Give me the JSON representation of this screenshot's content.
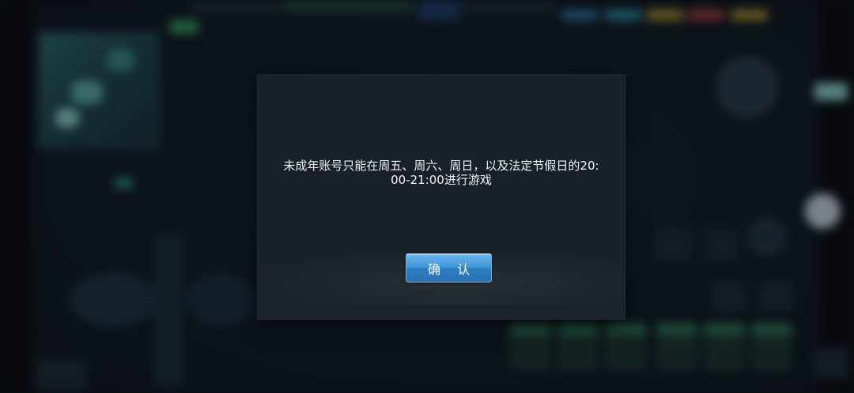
{
  "dialog": {
    "message": "未成年账号只能在周五、周六、周日，以及法定节假日的20:\n00-21:00进行游戏",
    "confirm_label": "确 认"
  },
  "colors": {
    "dialog_bg": "#1b2129",
    "button_blue": "#3f93d6",
    "text": "#f1f3f5"
  }
}
